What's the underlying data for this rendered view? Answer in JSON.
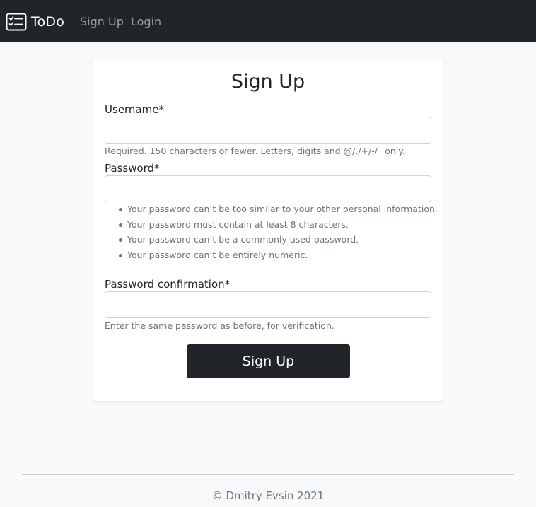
{
  "navbar": {
    "brand": "ToDo",
    "brand_icon": "checklist-icon",
    "links": [
      {
        "label": "Sign Up"
      },
      {
        "label": "Login"
      }
    ]
  },
  "form": {
    "title": "Sign Up",
    "username": {
      "label": "Username*",
      "value": "",
      "help": "Required. 150 characters or fewer. Letters, digits and @/./+/-/_ only."
    },
    "password": {
      "label": "Password*",
      "value": "",
      "rules": [
        "Your password can’t be too similar to your other personal information.",
        "Your password must contain at least 8 characters.",
        "Your password can’t be a commonly used password.",
        "Your password can’t be entirely numeric."
      ]
    },
    "password_confirmation": {
      "label": "Password confirmation*",
      "value": "",
      "help": "Enter the same password as before, for verification."
    },
    "submit_label": "Sign Up"
  },
  "footer": {
    "text": "© Dmitry Evsin 2021"
  },
  "colors": {
    "navbar_bg": "#212529",
    "page_bg": "#f8f9fa",
    "button_bg": "#212529",
    "muted_text": "#6c757d"
  }
}
